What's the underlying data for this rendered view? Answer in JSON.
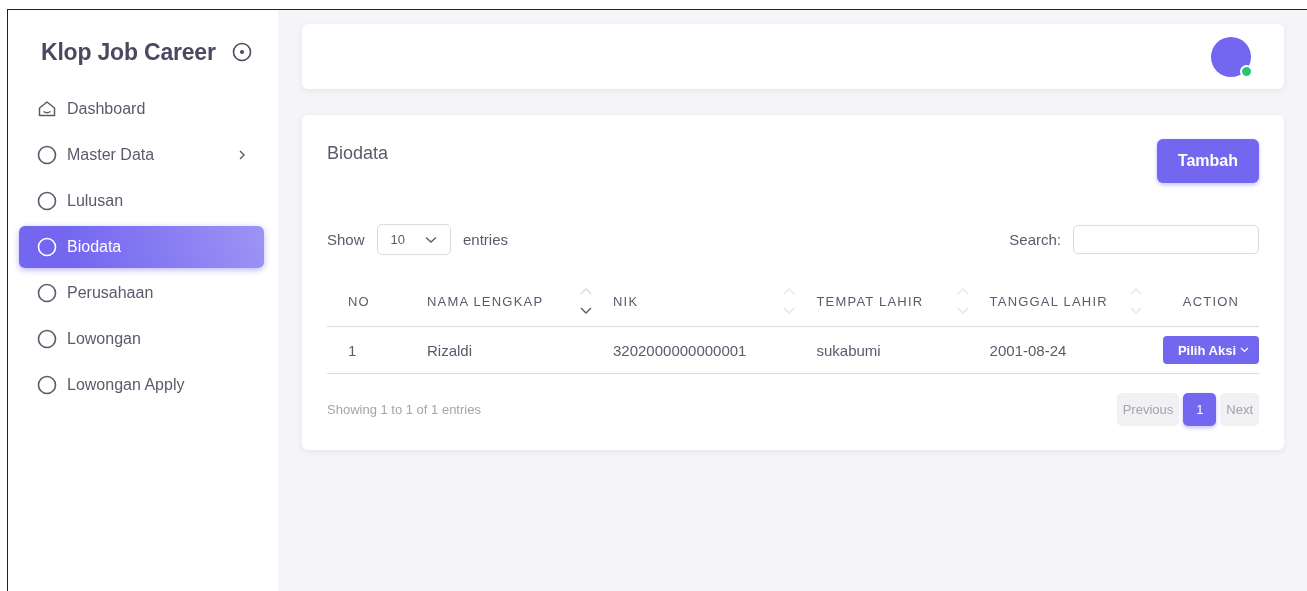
{
  "sidebar": {
    "brand": "Klop Job Career",
    "items": [
      {
        "label": "Dashboard",
        "kind": "home",
        "selected": false,
        "has_submenu": false
      },
      {
        "label": "Master Data",
        "kind": "circle",
        "selected": false,
        "has_submenu": true
      },
      {
        "label": "Lulusan",
        "kind": "circle",
        "selected": false,
        "has_submenu": false
      },
      {
        "label": "Biodata",
        "kind": "circle",
        "selected": true,
        "has_submenu": false
      },
      {
        "label": "Perusahaan",
        "kind": "circle",
        "selected": false,
        "has_submenu": false
      },
      {
        "label": "Lowongan",
        "kind": "circle",
        "selected": false,
        "has_submenu": false
      },
      {
        "label": "Lowongan Apply",
        "kind": "circle",
        "selected": false,
        "has_submenu": false
      }
    ]
  },
  "topbar": {
    "user_online": true
  },
  "card": {
    "title": "Biodata",
    "add_button": "Tambah",
    "show_label": "Show",
    "page_size": "10",
    "entries_label": "entries",
    "search_label": "Search:",
    "table": {
      "columns": [
        {
          "label": "NO",
          "sortable": false
        },
        {
          "label": "NAMA LENGKAP",
          "sortable": true,
          "sorted_ascending": true
        },
        {
          "label": "NIK",
          "sortable": true,
          "sorted_ascending": false
        },
        {
          "label": "TEMPAT LAHIR",
          "sortable": true,
          "sorted_ascending": false
        },
        {
          "label": "TANGGAL LAHIR",
          "sortable": true,
          "sorted_ascending": false
        },
        {
          "label": "ACTION",
          "sortable": false
        }
      ],
      "rows": [
        {
          "cells": [
            "1",
            "Rizaldi",
            "3202000000000001",
            "sukabumi",
            "2001-08-24"
          ],
          "action": "Pilih Aksi"
        }
      ]
    },
    "info": "Showing 1 to 1 of 1 entries",
    "pagination": [
      {
        "label": "Previous",
        "selected": false,
        "disabled": true
      },
      {
        "label": "1",
        "selected": true,
        "disabled": false
      },
      {
        "label": "Next",
        "selected": false,
        "disabled": true
      }
    ]
  }
}
